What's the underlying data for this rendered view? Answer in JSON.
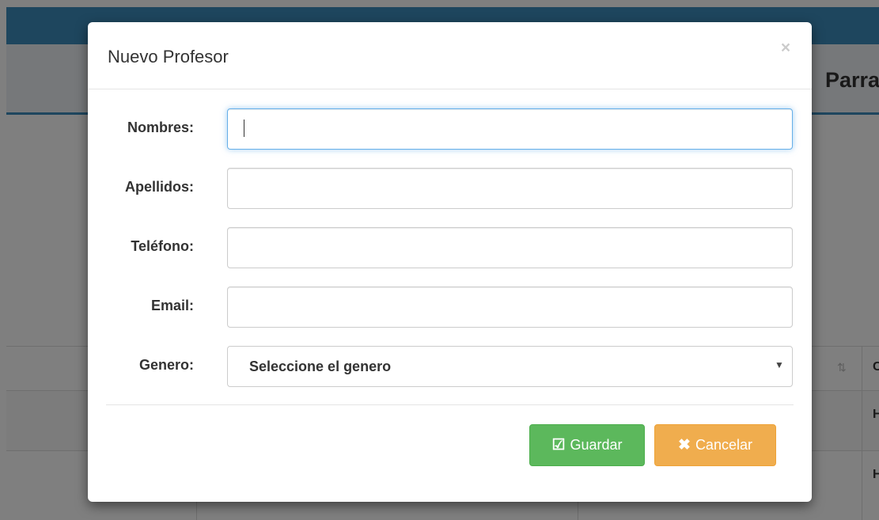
{
  "background": {
    "header_title": "Parra",
    "table_cells": [
      "C",
      "H",
      "H"
    ]
  },
  "modal": {
    "title": "Nuevo Profesor",
    "close_symbol": "×",
    "fields": {
      "nombres": {
        "label": "Nombres:",
        "value": "",
        "focused": true
      },
      "apellidos": {
        "label": "Apellidos:",
        "value": ""
      },
      "telefono": {
        "label": "Teléfono:",
        "value": ""
      },
      "email": {
        "label": "Email:",
        "value": ""
      },
      "genero": {
        "label": "Genero:",
        "selected": "Seleccione el genero"
      }
    },
    "buttons": {
      "save_label": "Guardar",
      "save_icon": "check-square-icon",
      "cancel_label": "Cancelar",
      "cancel_icon": "times-icon"
    }
  },
  "colors": {
    "primary": "#3c8dbc",
    "success": "#5cb85c",
    "warning": "#f0ad4e",
    "focus_border": "#66afe9"
  }
}
